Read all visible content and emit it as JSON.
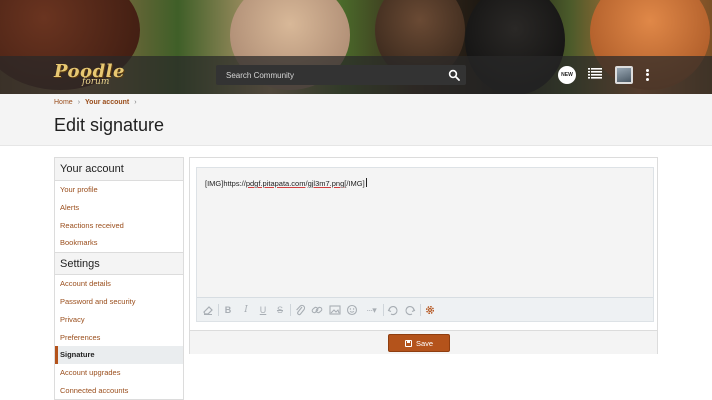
{
  "header": {
    "logo_main": "Poodle",
    "logo_sub": "forum",
    "search_placeholder": "Search Community",
    "new_badge": "NEW"
  },
  "breadcrumb": [
    {
      "label": "Home"
    },
    {
      "label": "Your account"
    }
  ],
  "page_title": "Edit signature",
  "sidebar": {
    "your_account_heading": "Your account",
    "account_items": [
      "Your profile",
      "Alerts",
      "Reactions received",
      "Bookmarks"
    ],
    "settings_heading": "Settings",
    "settings_items": [
      "Account details",
      "Password and security",
      "Privacy",
      "Preferences",
      "Signature",
      "Account upgrades",
      "Connected accounts"
    ],
    "active_item": "Signature"
  },
  "editor": {
    "content": {
      "p1": "[IMG]https://",
      "p2": "pdgf.pitapata.com",
      "p3": "/",
      "p4": "gjl3m7.png",
      "p5": "[/IMG]"
    },
    "toolbar_icons": [
      "eraser-icon",
      "bold-icon",
      "italic-icon",
      "underline-icon",
      "strikethrough-icon",
      "attach-icon",
      "link-icon",
      "image-icon",
      "emoji-icon",
      "more-options-icon",
      "undo-icon",
      "redo-icon",
      "settings-icon"
    ]
  },
  "save_label": "Save",
  "colors": {
    "accent": "#b4531b",
    "link": "#9a4e1c"
  }
}
